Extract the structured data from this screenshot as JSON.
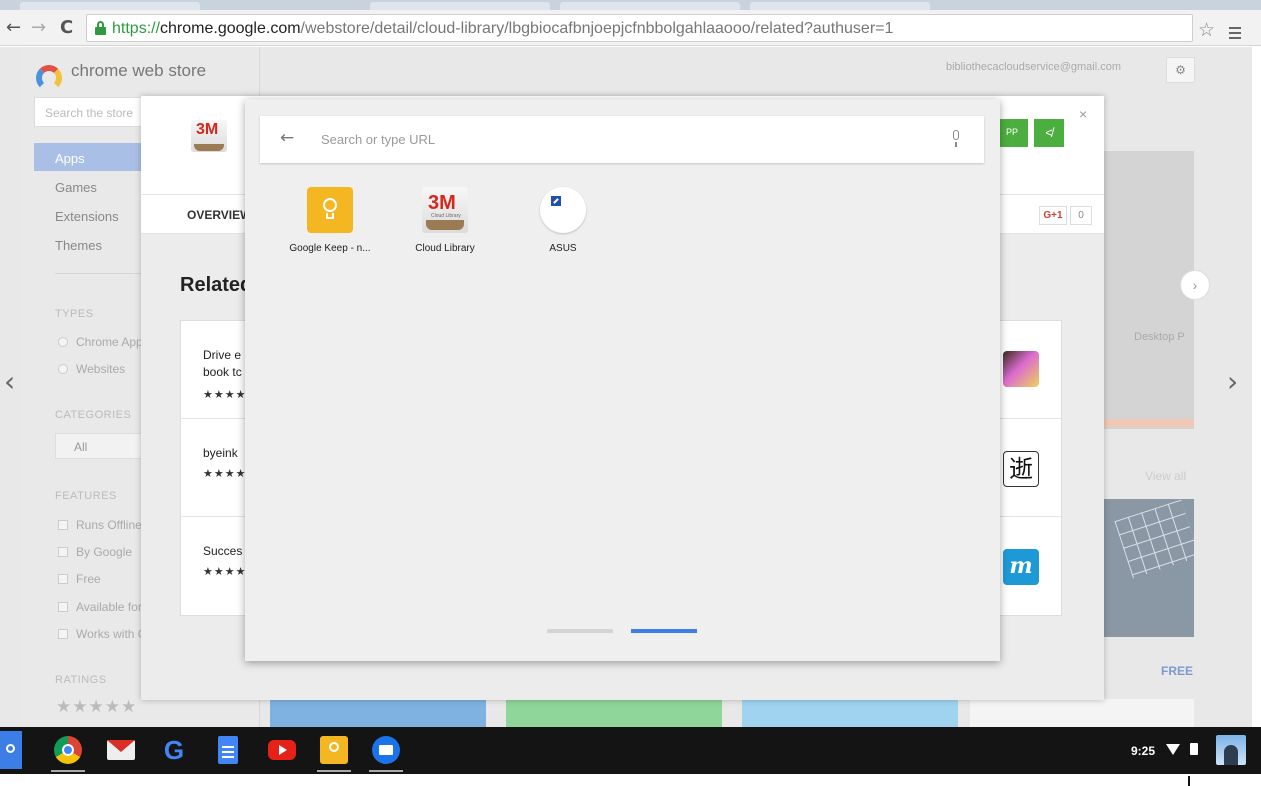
{
  "browser": {
    "nav": {
      "back": "←",
      "forward": "→",
      "reload": "C"
    },
    "url": {
      "scheme": "https://",
      "host": "chrome.google.com",
      "path": "/webstore/detail/cloud-library/lbgbiocafbnjoepjcfnbbolgahlaaooo/related?authuser=1"
    },
    "bookmark_icon": "star-outline-icon",
    "menu_icon": "hamburger-menu-icon"
  },
  "webstore": {
    "title": "chrome web store",
    "search_placeholder": "Search the store",
    "account": "bibliothecacloudservice@gmail.com",
    "nav": [
      {
        "label": "Apps",
        "active": true
      },
      {
        "label": "Games",
        "active": false
      },
      {
        "label": "Extensions",
        "active": false
      },
      {
        "label": "Themes",
        "active": false
      }
    ],
    "types_heading": "TYPES",
    "types": [
      "Chrome Apps",
      "Websites"
    ],
    "categories_heading": "CATEGORIES",
    "category_selected": "All",
    "features_heading": "FEATURES",
    "features": [
      "Runs Offline",
      "By Google",
      "Free",
      "Available for Android",
      "Works with Google Drive"
    ],
    "ratings_heading": "RATINGS",
    "rating_stars": "★★★★★",
    "side_panel_label": "Desktop P",
    "view_all": "View all",
    "free_label": "FREE",
    "carousel_prev": "‹",
    "carousel_next": "›",
    "circle_next": "›"
  },
  "detail": {
    "close": "×",
    "logo_text": "3M",
    "add_button": "PP",
    "share_icon": "share-icon",
    "tab_overview": "OVERVIEW",
    "gplus": "G+1",
    "gplus_count": "0",
    "related_title": "Related",
    "related": [
      {
        "name_line1": "Drive e",
        "name_line2": "book tc",
        "stars": "★★★★"
      },
      {
        "name_line1": "byeink",
        "name_line2": "",
        "stars": "★★★★"
      },
      {
        "name_line1": "Succes",
        "name_line2": "",
        "stars": "★★★★"
      }
    ]
  },
  "launcher": {
    "search_placeholder": "Search or type URL",
    "back_icon": "←",
    "apps": [
      {
        "label": "Google Keep - n...",
        "icon": "google-keep-icon"
      },
      {
        "label": "Cloud Library",
        "icon": "cloud-library-icon"
      },
      {
        "label": "ASUS",
        "icon": "asus-icon"
      }
    ],
    "cloud_library_logo": "3M",
    "cloud_library_sub": "Cloud Library",
    "current_page": 2,
    "page_count": 2
  },
  "shelf": {
    "apps": [
      "app-launcher-icon",
      "chrome-icon",
      "gmail-icon",
      "google-search-icon",
      "google-docs-icon",
      "youtube-icon",
      "google-keep-icon",
      "files-icon"
    ],
    "google_letter": "G",
    "clock": "9:25"
  },
  "colors": {
    "accent_blue": "#3d7ee6",
    "store_green": "#4cae3e",
    "secure_green": "#2e9b3f",
    "nav_active": "#a9bfe5"
  }
}
